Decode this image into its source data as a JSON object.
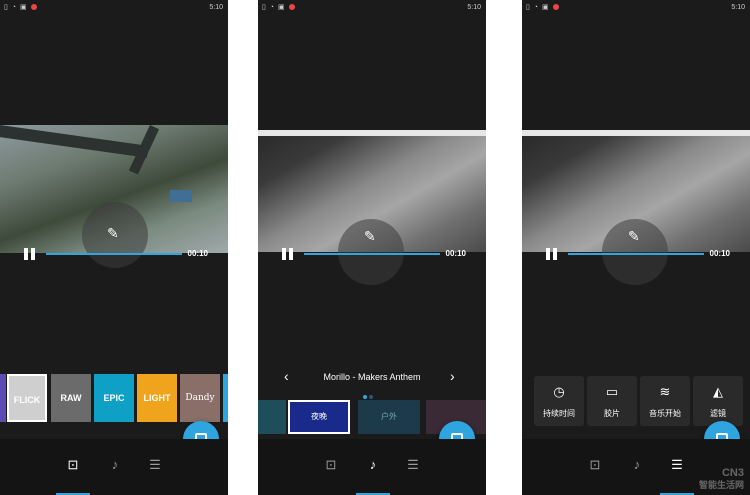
{
  "status_bar": {
    "time": "5:10"
  },
  "video": {
    "timestamp": "00:10"
  },
  "filters": [
    "FLICK",
    "RAW",
    "EPIC",
    "LIGHT",
    "Dandy"
  ],
  "music": {
    "title": "Morillo - Makers Anthem",
    "thumbnails": [
      "夜晚",
      "户外"
    ]
  },
  "tools": [
    {
      "label": "持续时间",
      "icon": "clock-icon"
    },
    {
      "label": "胶片",
      "icon": "film-icon"
    },
    {
      "label": "音乐开始",
      "icon": "waveform-icon"
    },
    {
      "label": "滤镜",
      "icon": "filter-icon"
    }
  ],
  "watermark": {
    "line1": "CN3",
    "line2": "智能生活网"
  },
  "colors": {
    "accent": "#2ea5df",
    "background": "#1b1b1b"
  }
}
